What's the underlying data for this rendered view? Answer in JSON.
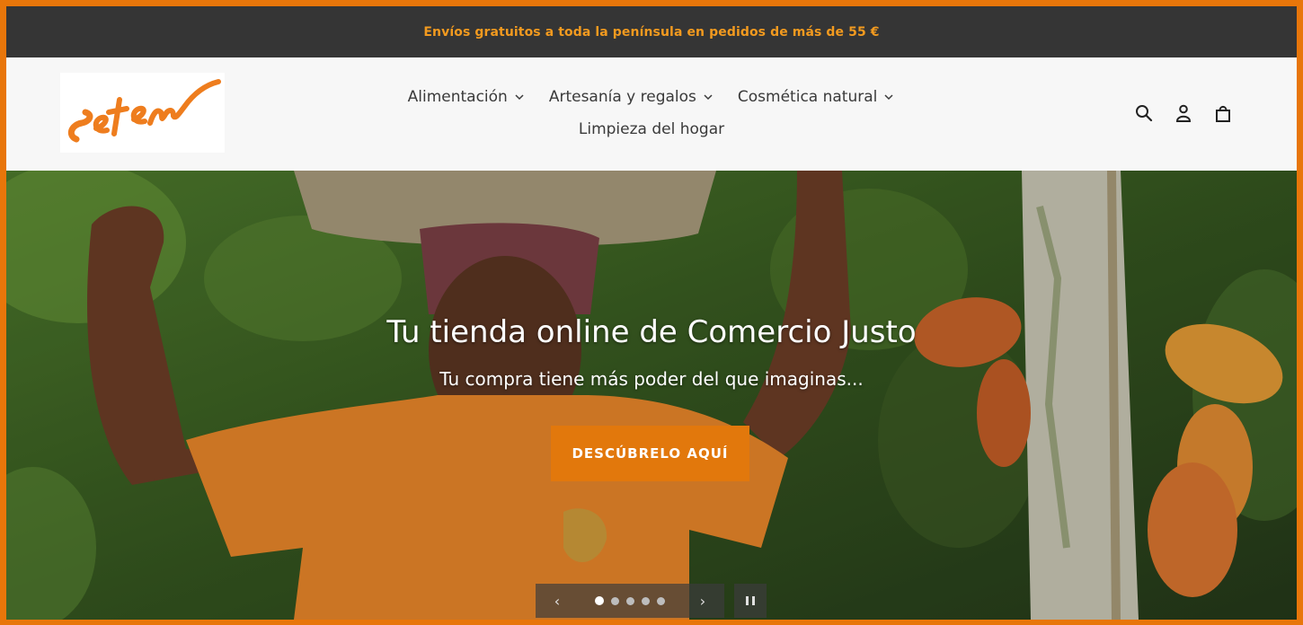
{
  "announcement": {
    "text": "Envíos gratuitos a toda la península en pedidos de más de 55 €"
  },
  "brand": {
    "logo_text": "Setem",
    "accent_color": "#e8760a"
  },
  "nav": {
    "items": [
      {
        "label": "Alimentación",
        "has_dropdown": true
      },
      {
        "label": "Artesanía y regalos",
        "has_dropdown": true
      },
      {
        "label": "Cosmética natural",
        "has_dropdown": true
      },
      {
        "label": "Limpieza del hogar",
        "has_dropdown": false
      }
    ]
  },
  "header_icons": [
    "search-icon",
    "account-icon",
    "cart-icon"
  ],
  "hero": {
    "title": "Tu tienda online de Comercio Justo",
    "subtitle": "Tu compra tiene más poder del que imaginas...",
    "cta_label": "DESCÚBRELO AQUÍ",
    "cta_color": "#e2780c"
  },
  "slideshow": {
    "prev_label": "‹",
    "next_label": "›",
    "slide_count": 5,
    "active_slide": 1
  }
}
